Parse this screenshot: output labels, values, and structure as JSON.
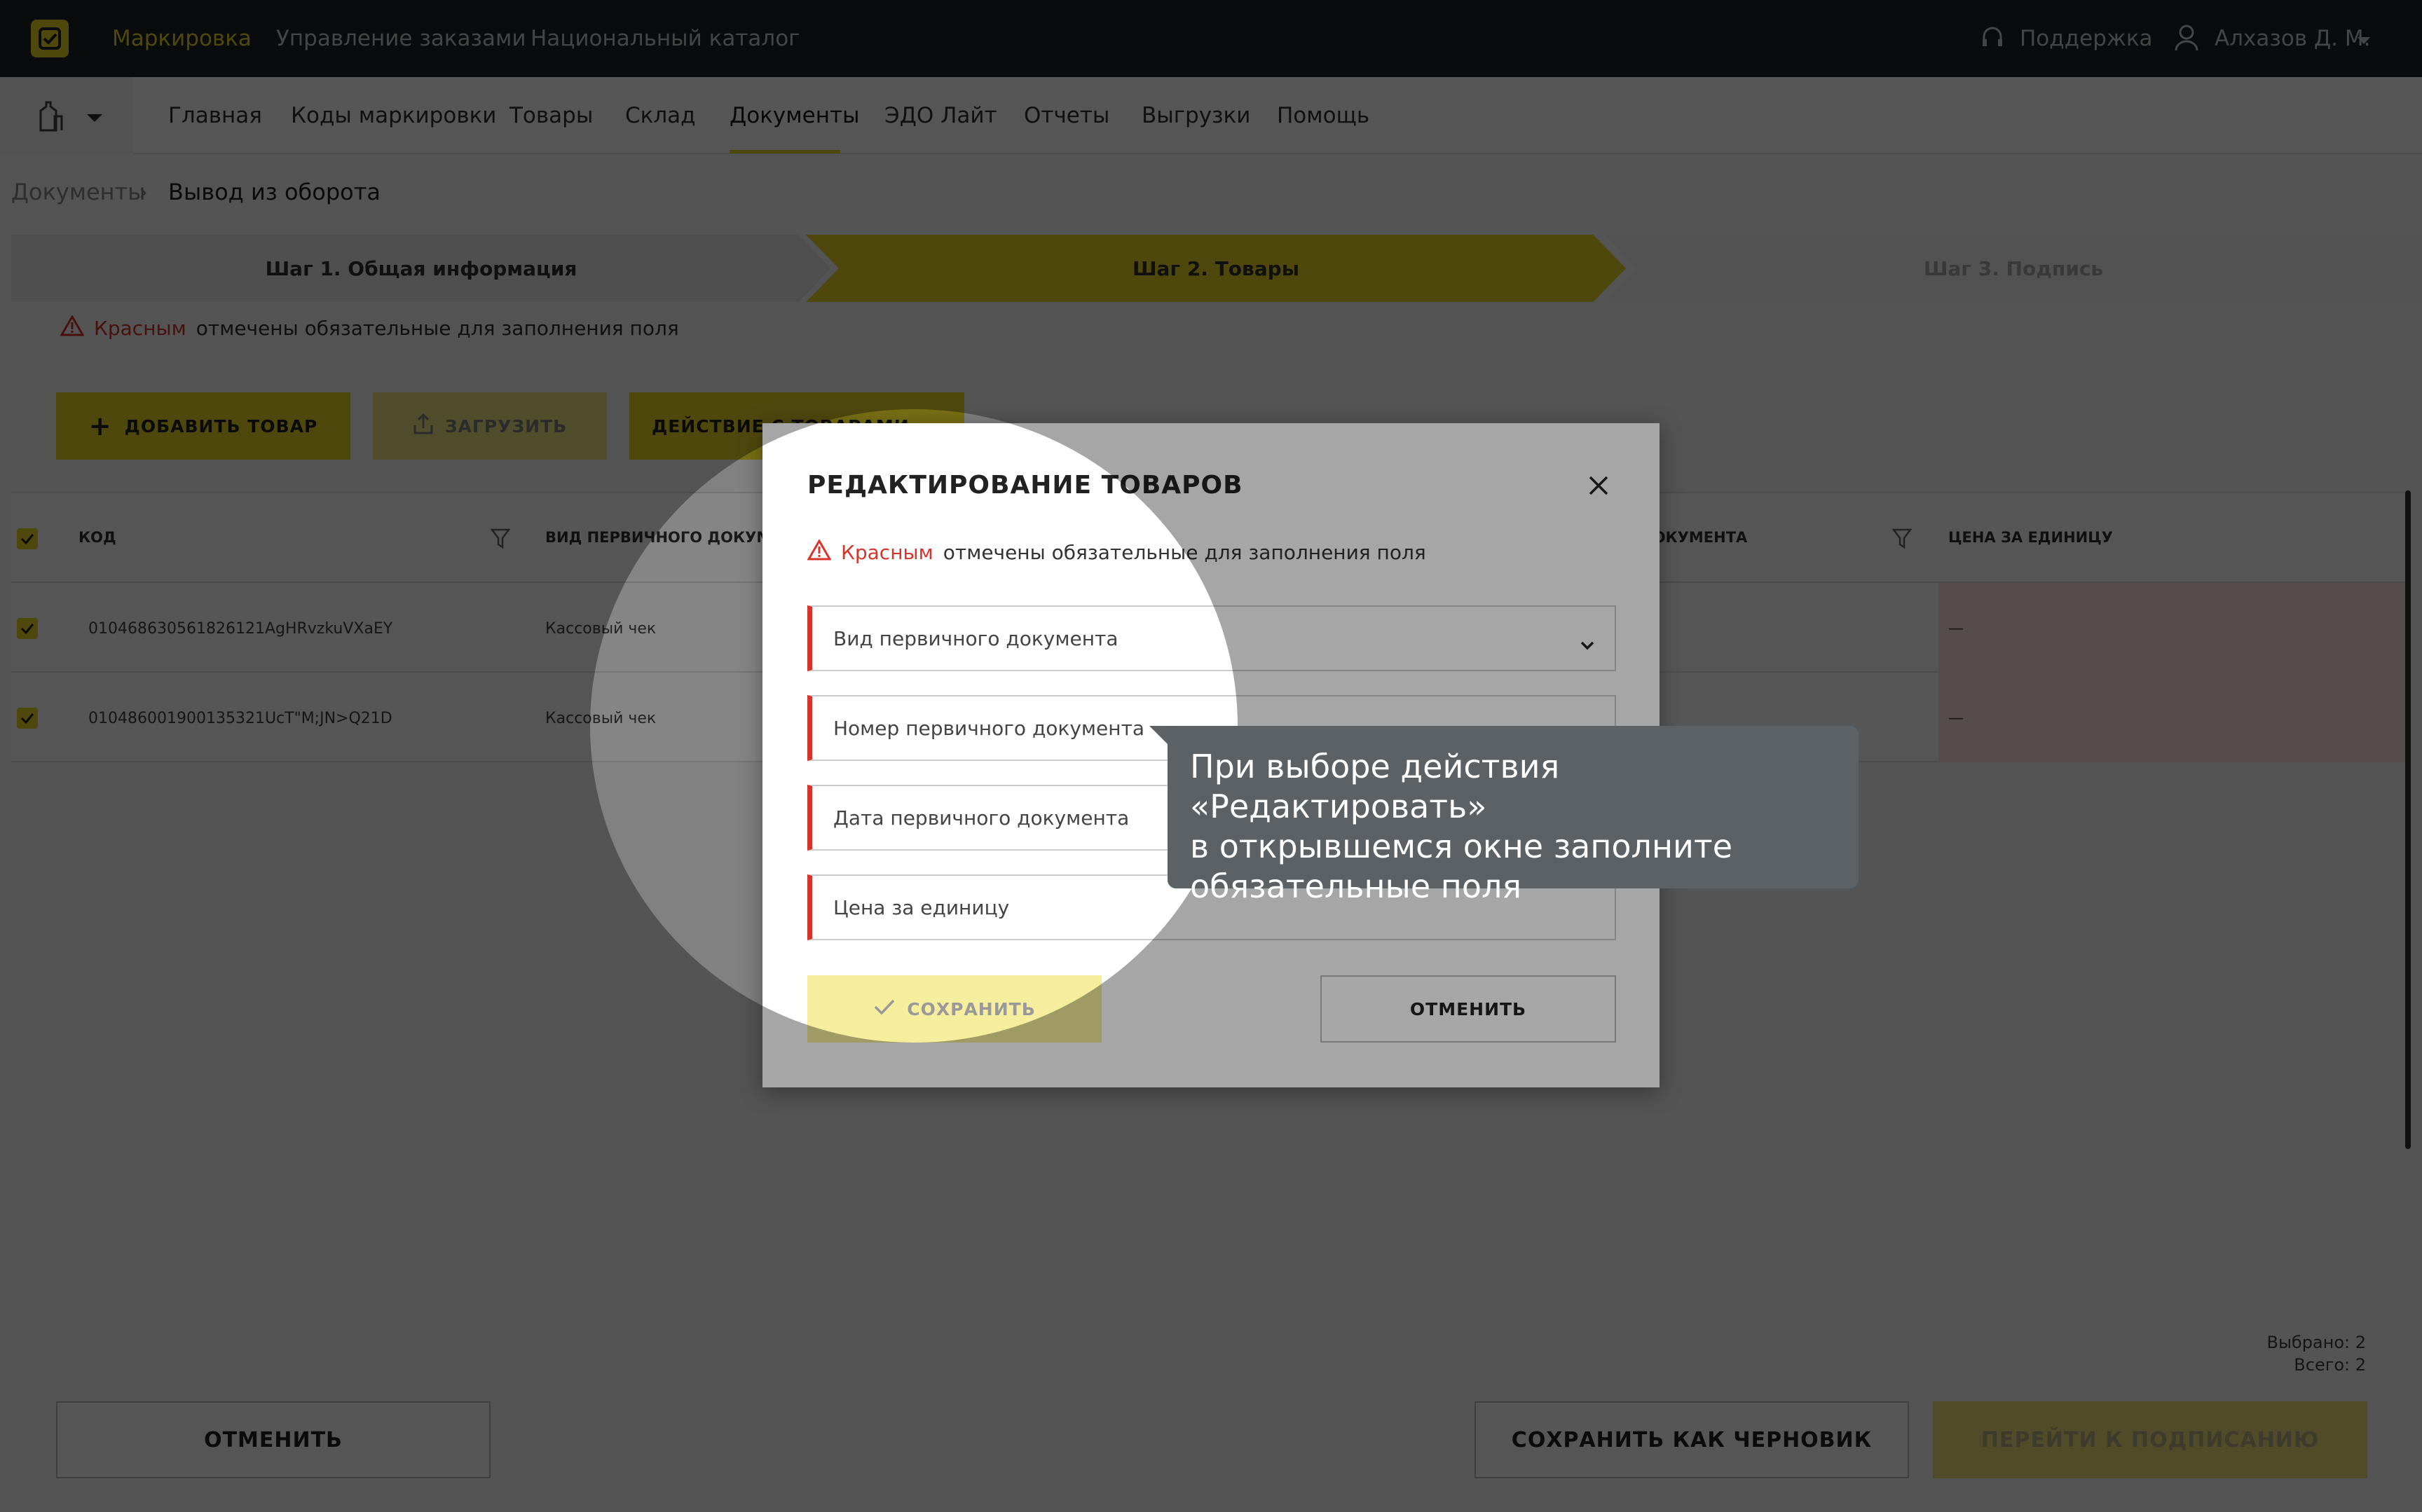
{
  "topbar": {
    "nav": [
      "Маркировка",
      "Управление заказами",
      "Национальный каталог"
    ],
    "support": "Поддержка",
    "user": "Алхазов Д. М."
  },
  "secnav": [
    "Главная",
    "Коды маркировки",
    "Товары",
    "Склад",
    "Документы",
    "ЭДО Лайт",
    "Отчеты",
    "Выгрузки",
    "Помощь"
  ],
  "breadcrumb": {
    "root": "Документы",
    "current": "Вывод из оборота"
  },
  "steps": [
    "Шаг 1. Общая информация",
    "Шаг 2. Товары",
    "Шаг 3. Подпись"
  ],
  "hint": {
    "red": "Красным",
    "rest": "отмечены обязательные для заполнения поля"
  },
  "toolbar": {
    "add": "Добавить товар",
    "upload": "Загрузить",
    "action": "Действие с товарами"
  },
  "table": {
    "headers": [
      "КОД",
      "ВИД ПЕРВИЧНОГО ДОКУМЕНТА",
      "ДОКУМЕНТА",
      "ЦЕНА ЗА ЕДИНИЦУ"
    ],
    "rows": [
      {
        "code": "010468630561826121AgHRvzkuVXaEY",
        "doc": "Кассовый чек",
        "price": "—"
      },
      {
        "code": "010486001900135321UcT\"M;JN>Q21D",
        "doc": "Кассовый чек",
        "price": "—"
      }
    ]
  },
  "footer": {
    "selected": "Выбрано: 2",
    "total": "Всего: 2",
    "cancel": "Отменить",
    "draft": "Сохранить как черновик",
    "sign": "Перейти к подписанию"
  },
  "modal": {
    "title": "РЕДАКТИРОВАНИЕ ТОВАРОВ",
    "hint_red": "Красным",
    "hint_rest": "отмечены обязательные для заполнения поля",
    "fields": [
      "Вид первичного документа",
      "Номер первичного документа",
      "Дата первичного документа",
      "Цена за единицу"
    ],
    "save": "Сохранить",
    "cancel": "Отменить"
  },
  "tooltip": {
    "line1": "При выборе действия «Редактировать»",
    "line2": "в открывшемся окне заполните",
    "line3": "обязательные поля"
  },
  "colors": {
    "accent": "#e8d52a",
    "required": "#d9342b",
    "topbar": "#1f2329",
    "tooltip": "#5c6166"
  }
}
